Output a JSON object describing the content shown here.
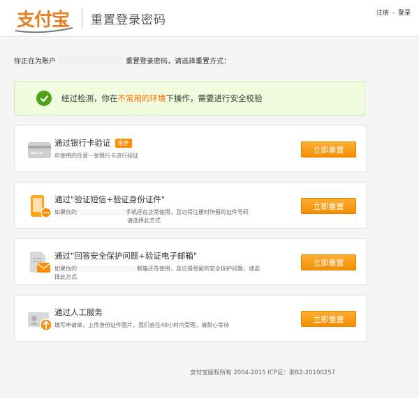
{
  "header": {
    "logo_text": "支付宝",
    "page_title": "重置登录密码",
    "links": {
      "register": "注册",
      "separator": "-",
      "login": "登录"
    }
  },
  "account_line": {
    "prefix": "你正在为账户",
    "suffix": "重置登录密码，请选择重置方式："
  },
  "notice": {
    "part1": "经过检测，你在",
    "highlight": "不常用的环境",
    "part2": "下操作，需要进行安全校验"
  },
  "options": [
    {
      "title": "通过银行卡验证",
      "badge": "推荐",
      "desc": "可使用的任意一张银行卡进行验证",
      "button": "立即重置",
      "icon": "bank-card-icon"
    },
    {
      "title": "通过\"验证短信+验证身份证件\"",
      "desc_a": "如果你的",
      "desc_b": "手机还在正常使用，且记得注册时所留的证件号码",
      "desc_c": "请选择此方式",
      "button": "立即重置",
      "icon": "mobile-phone-icon"
    },
    {
      "title": "通过\"回答安全保护问题+验证电子邮箱\"",
      "desc_a": "如果你的",
      "desc_b": "邮箱还在使用，且记得预留的安全保护问题，请选",
      "desc_c": "择此方式",
      "button": "立即重置",
      "icon": "document-mail-icon"
    },
    {
      "title": "通过人工服务",
      "desc": "填写申请单，上传身份证件图片，我们会在48小时内受理，请耐心等待",
      "button": "立即重置",
      "icon": "id-upload-icon"
    }
  ],
  "footer": "支付宝版权所有 2004-2015 ICP证：浙B2-20100257",
  "colors": {
    "accent": "#ff8a00",
    "success": "#4ea21a",
    "highlight": "#ff6600"
  }
}
